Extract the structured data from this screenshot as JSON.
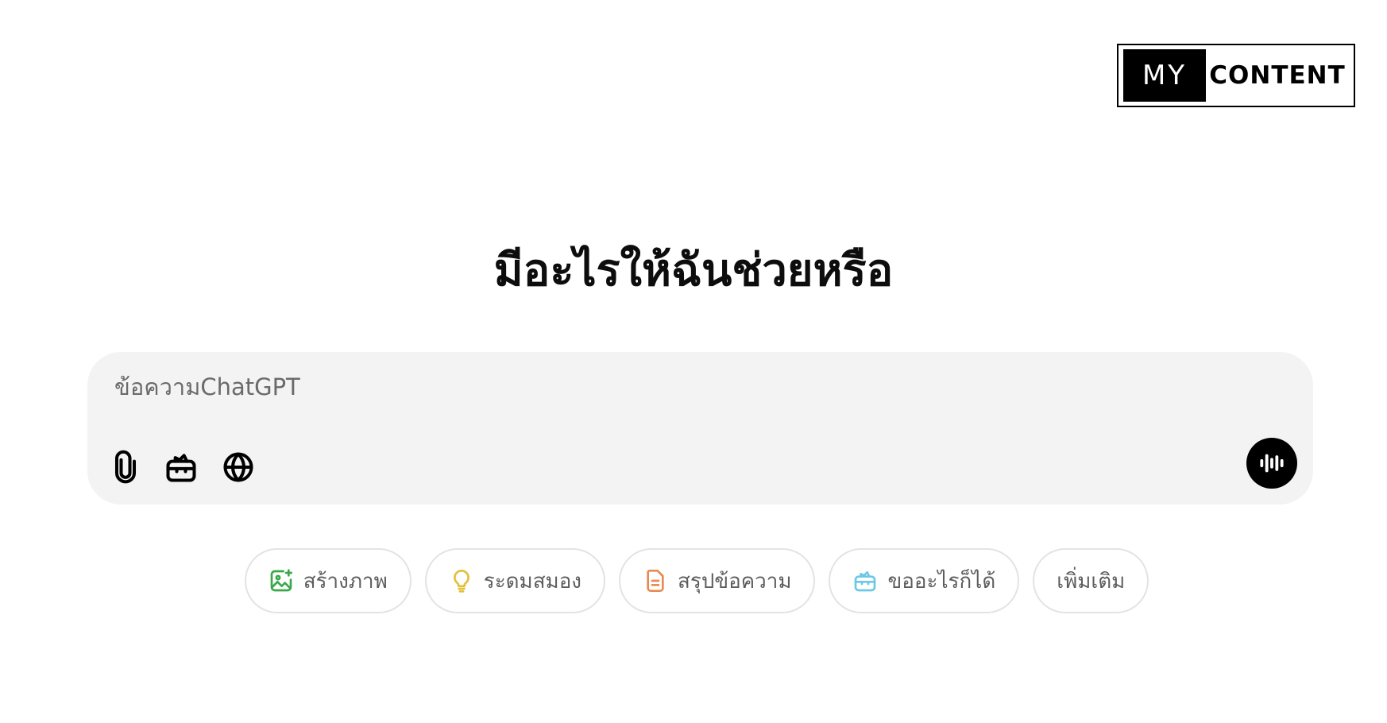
{
  "watermark": {
    "part1": "MY",
    "part2": "CONTENT"
  },
  "heading": "มีอะไรให้ฉันช่วยหรือ",
  "composer": {
    "placeholder": "ข้อความChatGPT",
    "tools": [
      {
        "icon": "paperclip-icon"
      },
      {
        "icon": "toolbox-icon"
      },
      {
        "icon": "globe-icon"
      }
    ],
    "voice_icon": "voice-waveform-icon"
  },
  "suggestions": [
    {
      "label": "สร้างภาพ",
      "icon": "image-sparkle-icon",
      "color": "#3aa84a"
    },
    {
      "label": "ระดมสมอง",
      "icon": "lightbulb-icon",
      "color": "#e2c13b"
    },
    {
      "label": "สรุปข้อความ",
      "icon": "document-icon",
      "color": "#e98a54"
    },
    {
      "label": "ขออะไรก็ได้",
      "icon": "toolbox-icon",
      "color": "#6cc8e4"
    },
    {
      "label": "เพิ่มเติม"
    }
  ]
}
